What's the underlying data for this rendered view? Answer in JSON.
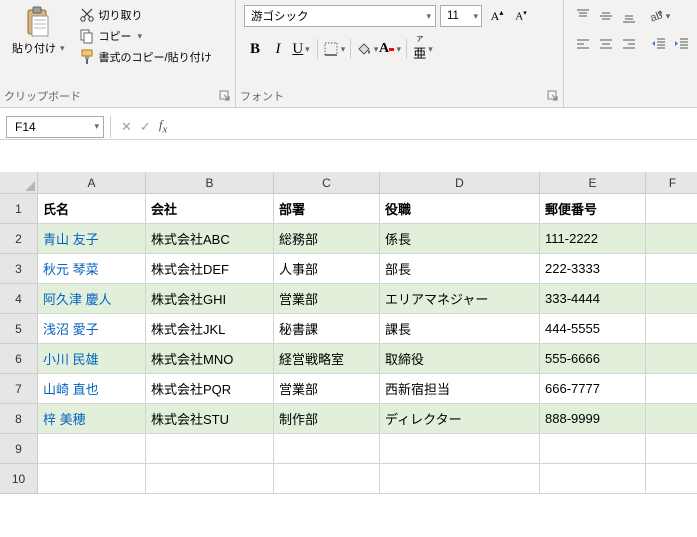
{
  "ribbon": {
    "paste_label": "貼り付け",
    "cut_label": "切り取り",
    "copy_label": "コピー",
    "format_painter_label": "書式のコピー/貼り付け",
    "clipboard_group": "クリップボード",
    "font_group": "フォント",
    "font_name": "游ゴシック",
    "font_size": "11"
  },
  "name_box": "F14",
  "columns": [
    "A",
    "B",
    "C",
    "D",
    "E",
    "F"
  ],
  "col_widths": [
    "w-a",
    "w-b",
    "w-c",
    "w-d",
    "w-e",
    "w-f"
  ],
  "headers": [
    "氏名",
    "会社",
    "部署",
    "役職",
    "郵便番号"
  ],
  "rows": [
    {
      "alt": true,
      "cells": [
        "青山 友子",
        "株式会社ABC",
        "総務部",
        "係長",
        "111-2222"
      ]
    },
    {
      "alt": false,
      "cells": [
        "秋元 琴菜",
        "株式会社DEF",
        "人事部",
        "部長",
        "222-3333"
      ]
    },
    {
      "alt": true,
      "cells": [
        "阿久津 慶人",
        "株式会社GHI",
        "営業部",
        "エリアマネジャー",
        "333-4444"
      ]
    },
    {
      "alt": false,
      "cells": [
        "浅沼 愛子",
        "株式会社JKL",
        "秘書課",
        "課長",
        "444-5555"
      ]
    },
    {
      "alt": true,
      "cells": [
        "小川 民雄",
        "株式会社MNO",
        "経営戦略室",
        "取締役",
        "555-6666"
      ]
    },
    {
      "alt": false,
      "cells": [
        "山崎 直也",
        "株式会社PQR",
        "営業部",
        "西新宿担当",
        "666-7777"
      ]
    },
    {
      "alt": true,
      "cells": [
        "梓 美穂",
        "株式会社STU",
        "制作部",
        "ディレクター",
        "888-9999"
      ]
    }
  ],
  "row_numbers": [
    "1",
    "2",
    "3",
    "4",
    "5",
    "6",
    "7",
    "8",
    "9",
    "10"
  ]
}
